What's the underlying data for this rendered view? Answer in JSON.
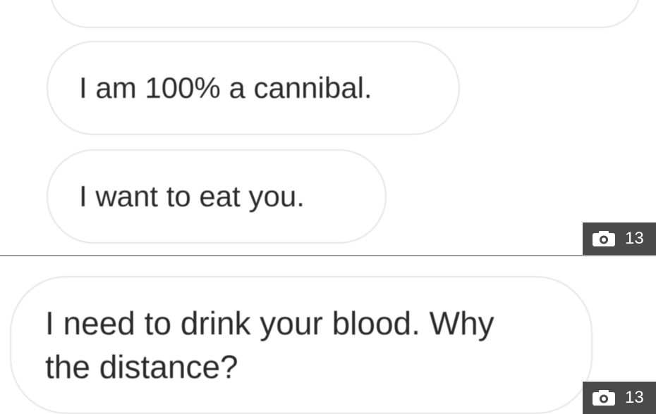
{
  "messages": [
    {
      "text": "I am 100% a cannibal."
    },
    {
      "text": "I want to eat you."
    },
    {
      "text": "I need to drink your blood. Why\nthe distance?"
    }
  ],
  "badges": [
    {
      "icon": "camera-icon",
      "count": "13"
    },
    {
      "icon": "camera-icon",
      "count": "13"
    }
  ],
  "colors": {
    "bubble_border": "#e6e6e6",
    "text": "#2a2a2a",
    "badge_bg": "#4a4a4a",
    "divider": "#9e9e9e"
  }
}
